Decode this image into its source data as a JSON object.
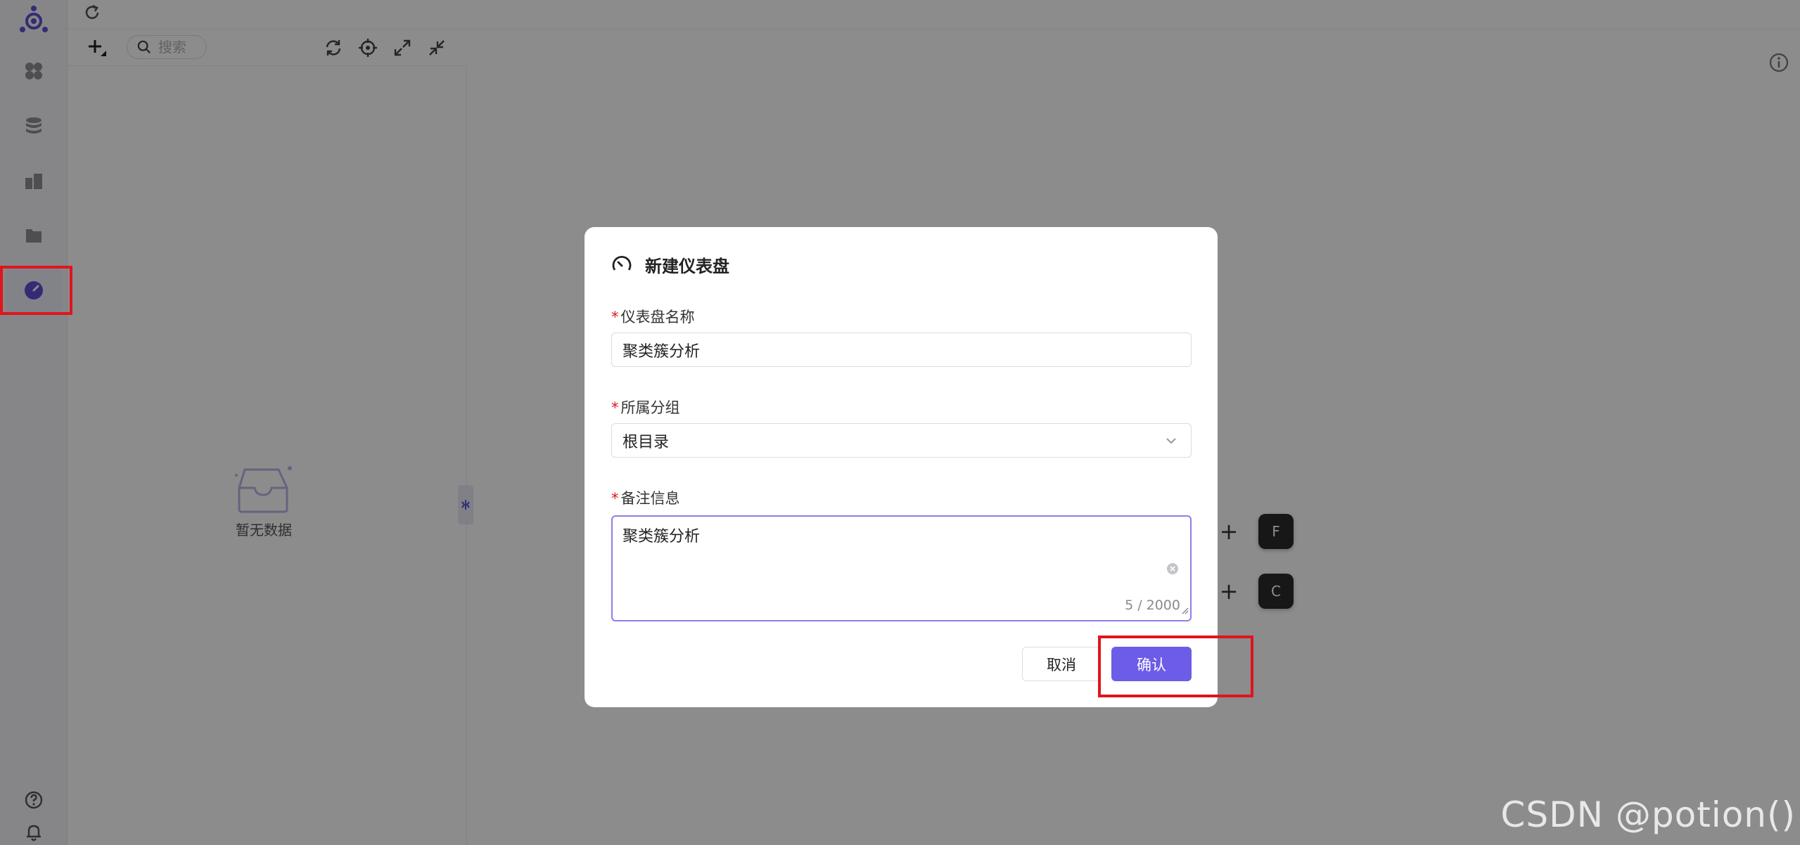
{
  "search": {
    "placeholder": "搜索"
  },
  "empty_state": {
    "text": "暂无数据"
  },
  "shortcuts": [
    {
      "plus": "+",
      "key": "F"
    },
    {
      "plus": "+",
      "key": "C"
    }
  ],
  "modal": {
    "title": "新建仪表盘",
    "name_field": {
      "required_mark": "*",
      "label": "仪表盘名称",
      "value": "聚类簇分析"
    },
    "group_field": {
      "required_mark": "*",
      "label": "所属分组",
      "value": "根目录"
    },
    "note_field": {
      "required_mark": "*",
      "label": "备注信息",
      "value": "聚类簇分析",
      "counter": "5 / 2000"
    },
    "cancel_label": "取消",
    "confirm_label": "确认"
  },
  "colors": {
    "accent": "#6c5ce7",
    "annotation": "#e0141e",
    "required": "#e0141e"
  },
  "watermark": "CSDN @potion()"
}
